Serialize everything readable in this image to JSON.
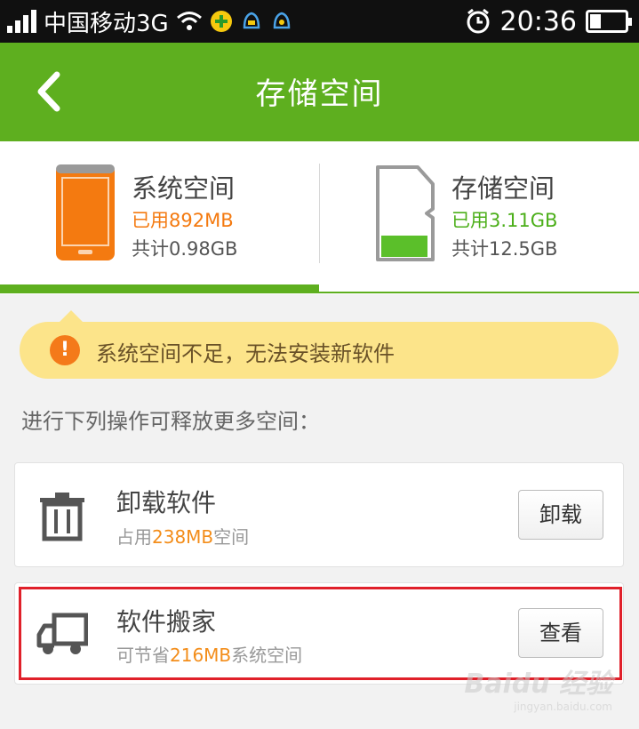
{
  "status_bar": {
    "carrier": "中国移动3G",
    "time": "20:36"
  },
  "header": {
    "title": "存储空间"
  },
  "storage": {
    "system": {
      "name": "系统空间",
      "used": "已用892MB",
      "total": "共计0.98GB",
      "color": "#f47a10"
    },
    "sd": {
      "name": "存储空间",
      "used": "已用3.11GB",
      "total": "共计12.5GB",
      "color": "#4caf1a"
    }
  },
  "warning": {
    "icon": "!",
    "text": "系统空间不足，无法安装新软件"
  },
  "hint": "进行下列操作可释放更多空间：",
  "actions": [
    {
      "title": "卸载软件",
      "sub_prefix": "占用",
      "sub_value": "238MB",
      "sub_suffix": "空间",
      "button": "卸载",
      "icon": "trash-icon"
    },
    {
      "title": "软件搬家",
      "sub_prefix": "可节省",
      "sub_value": "216MB",
      "sub_suffix": "系统空间",
      "button": "查看",
      "icon": "truck-icon"
    }
  ],
  "watermark": {
    "main": "Baidu 经验",
    "sub": "jingyan.baidu.com"
  },
  "colors": {
    "brand_green": "#5eaf1f",
    "warning_bg": "#fce48a",
    "accent_orange": "#f38d1a",
    "highlight_red": "#e0202a"
  }
}
